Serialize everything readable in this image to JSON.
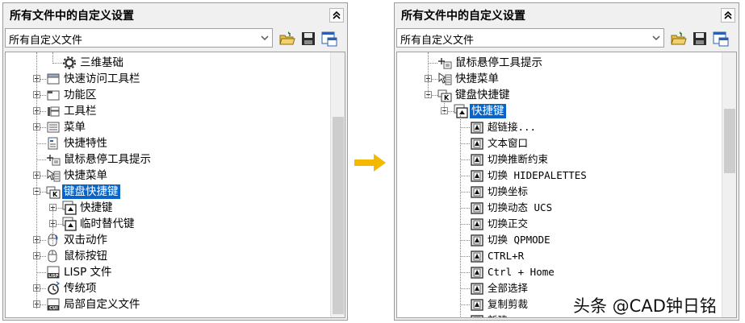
{
  "left_panel": {
    "title": "所有文件中的自定义设置",
    "combo_value": "所有自定义文件",
    "tree": [
      {
        "label": "三维基础",
        "icon": "gear-icon",
        "depth": 2,
        "exp": "none",
        "mono": false
      },
      {
        "label": "快速访问工具栏",
        "icon": "quick-access-toolbar-icon",
        "depth": 1,
        "exp": "plus",
        "mono": false
      },
      {
        "label": "功能区",
        "icon": "ribbon-icon",
        "depth": 1,
        "exp": "plus",
        "mono": false
      },
      {
        "label": "工具栏",
        "icon": "toolbar-icon",
        "depth": 1,
        "exp": "plus",
        "mono": false
      },
      {
        "label": "菜单",
        "icon": "menu-icon",
        "depth": 1,
        "exp": "plus",
        "mono": false
      },
      {
        "label": "快捷特性",
        "icon": "quick-properties-icon",
        "depth": 1,
        "exp": "none",
        "mono": false
      },
      {
        "label": "鼠标悬停工具提示",
        "icon": "rollover-tooltip-icon",
        "depth": 1,
        "exp": "none",
        "mono": false
      },
      {
        "label": "快捷菜单",
        "icon": "shortcut-menu-icon",
        "depth": 1,
        "exp": "plus",
        "mono": false
      },
      {
        "label": "键盘快捷键",
        "icon": "keyboard-icon",
        "depth": 1,
        "exp": "minus",
        "mono": false,
        "selected": true
      },
      {
        "label": "快捷键",
        "icon": "shortcut-key-icon",
        "depth": 2,
        "exp": "plus",
        "mono": false
      },
      {
        "label": "临时替代键",
        "icon": "shortcut-key-icon",
        "depth": 2,
        "exp": "plus",
        "mono": false
      },
      {
        "label": "双击动作",
        "icon": "double-click-icon",
        "depth": 1,
        "exp": "plus",
        "mono": false
      },
      {
        "label": "鼠标按钮",
        "icon": "mouse-icon",
        "depth": 1,
        "exp": "plus",
        "mono": false
      },
      {
        "label": "LISP 文件",
        "icon": "lisp-file-icon",
        "depth": 1,
        "exp": "none",
        "mono": false
      },
      {
        "label": "传统项",
        "icon": "legacy-icon",
        "depth": 1,
        "exp": "plus",
        "mono": false
      },
      {
        "label": "局部自定义文件",
        "icon": "cui-file-icon",
        "depth": 1,
        "exp": "plus",
        "mono": false
      }
    ]
  },
  "right_panel": {
    "title": "所有文件中的自定义设置",
    "combo_value": "所有自定义文件",
    "tree": [
      {
        "label": "鼠标悬停工具提示",
        "icon": "rollover-tooltip-icon",
        "depth": 1,
        "exp": "none",
        "mono": false
      },
      {
        "label": "快捷菜单",
        "icon": "shortcut-menu-icon",
        "depth": 1,
        "exp": "plus",
        "mono": false
      },
      {
        "label": "键盘快捷键",
        "icon": "keyboard-icon",
        "depth": 1,
        "exp": "minus",
        "mono": false
      },
      {
        "label": "快捷键",
        "icon": "shortcut-key-icon",
        "depth": 2,
        "exp": "minus",
        "mono": false,
        "selected": true
      },
      {
        "label": "超链接...",
        "icon": "key-item-icon",
        "depth": 3,
        "exp": "none",
        "mono": true
      },
      {
        "label": "文本窗口",
        "icon": "key-item-icon",
        "depth": 3,
        "exp": "none",
        "mono": true
      },
      {
        "label": "切换推断约束",
        "icon": "key-item-icon",
        "depth": 3,
        "exp": "none",
        "mono": true
      },
      {
        "label": "切换 HIDEPALETTES",
        "icon": "key-item-icon",
        "depth": 3,
        "exp": "none",
        "mono": true
      },
      {
        "label": "切换坐标",
        "icon": "key-item-icon",
        "depth": 3,
        "exp": "none",
        "mono": true
      },
      {
        "label": "切换动态 UCS",
        "icon": "key-item-icon",
        "depth": 3,
        "exp": "none",
        "mono": true
      },
      {
        "label": "切换正交",
        "icon": "key-item-icon",
        "depth": 3,
        "exp": "none",
        "mono": true
      },
      {
        "label": "切换 QPMODE",
        "icon": "key-item-icon",
        "depth": 3,
        "exp": "none",
        "mono": true
      },
      {
        "label": "CTRL+R",
        "icon": "key-item-icon",
        "depth": 3,
        "exp": "none",
        "mono": true
      },
      {
        "label": "Ctrl + Home",
        "icon": "key-item-icon",
        "depth": 3,
        "exp": "none",
        "mono": true
      },
      {
        "label": "全部选择",
        "icon": "key-item-icon",
        "depth": 3,
        "exp": "none",
        "mono": true
      },
      {
        "label": "复制剪裁",
        "icon": "key-item-icon",
        "depth": 3,
        "exp": "none",
        "mono": true
      },
      {
        "label": "新建",
        "icon": "key-item-icon",
        "depth": 3,
        "exp": "none",
        "mono": true
      }
    ]
  },
  "watermark": "头条 @CAD钟日铭",
  "colors": {
    "selection": "#0a64c8",
    "arrow": "#f5b800"
  }
}
